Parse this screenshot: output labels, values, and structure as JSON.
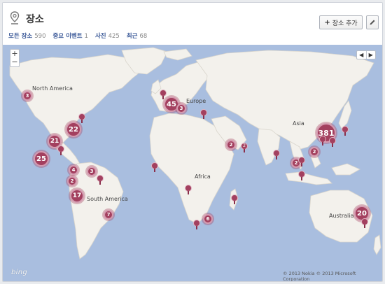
{
  "header": {
    "title": "장소",
    "add_button_label": "장소 추가",
    "add_icon": "+",
    "edit_icon": "pencil-icon",
    "title_icon": "map-pin-icon"
  },
  "stats": [
    {
      "label": "모든 장소",
      "count": "590"
    },
    {
      "label": "중요 이벤트",
      "count": "1"
    },
    {
      "label": "사진",
      "count": "425"
    },
    {
      "label": "최근",
      "count": "68"
    }
  ],
  "map": {
    "zoom_in": "+",
    "zoom_out": "−",
    "prev": "◀",
    "next": "▶",
    "labels": {
      "north_america": "North America",
      "europe": "Europe",
      "asia": "Asia",
      "africa": "Africa",
      "south_america": "South America",
      "australia": "Australia"
    },
    "clusters": [
      "3",
      "45",
      "3",
      "22",
      "21",
      "25",
      "381",
      "2",
      "2",
      "2",
      "4",
      "3",
      "2",
      "17",
      "7",
      "6",
      "20"
    ],
    "pin_counts": [
      "2"
    ],
    "brand": "bing",
    "copyright": "© 2013 Nokia   © 2013 Microsoft Corporation",
    "colors": {
      "water": "#a9bedf",
      "land": "#f3f1ec",
      "marker": "#a3405f"
    }
  }
}
